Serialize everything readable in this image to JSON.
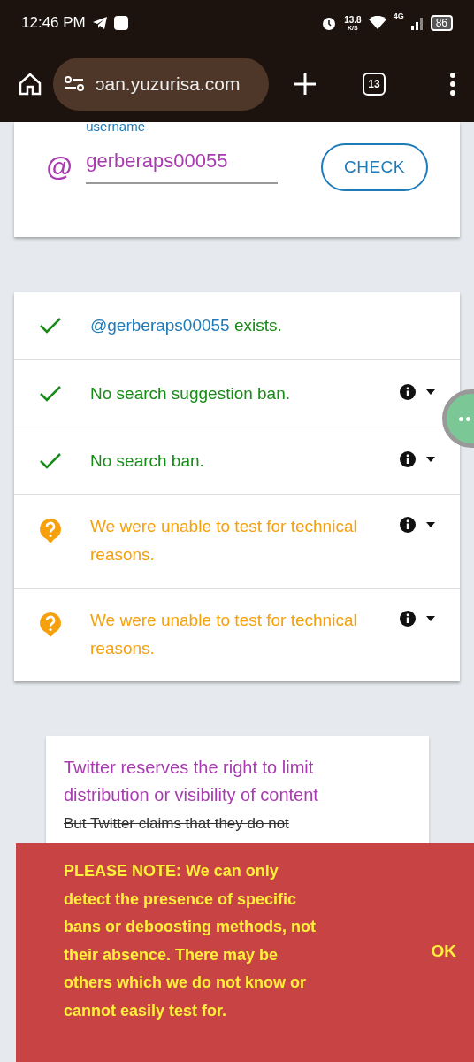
{
  "status_bar": {
    "time": "12:46 PM",
    "net_speed": "13.8",
    "net_unit": "K/S",
    "network": "4G",
    "battery": "86"
  },
  "browser": {
    "url": "ɔan.yuzurisa.com",
    "tab_count": "13"
  },
  "search_card": {
    "label": "username",
    "at": "@",
    "value": "gerberaps00055",
    "button": "CHECK"
  },
  "results": [
    {
      "kind": "exists",
      "passed": true,
      "handle": "@gerberaps00055",
      "text": " exists."
    },
    {
      "kind": "test",
      "passed": true,
      "text": "No search suggestion ban."
    },
    {
      "kind": "test",
      "passed": true,
      "text": "No search ban."
    },
    {
      "kind": "test",
      "passed": false,
      "text": "We were unable to test for technical reasons."
    },
    {
      "kind": "test",
      "passed": false,
      "text": "We were unable to test for technical reasons."
    }
  ],
  "info_card": {
    "heading": "Twitter reserves the right to limit distribution or visibility of content",
    "struck": "But Twitter claims that they do not"
  },
  "notice": {
    "text": "PLEASE NOTE: We can only detect the presence of specific bans or deboosting methods, not their absence. There may be others which we do not know or cannot easily test for.",
    "button": "OK"
  }
}
